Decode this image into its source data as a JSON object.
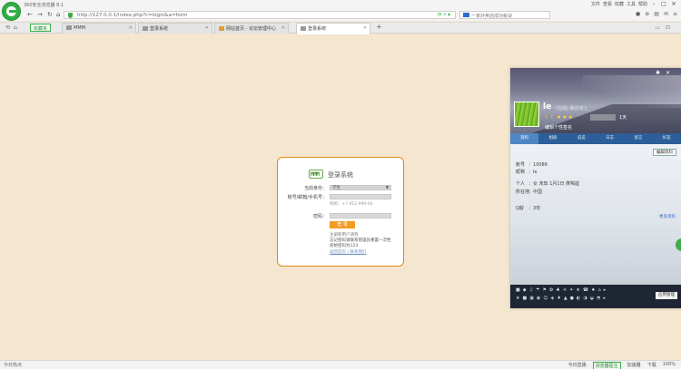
{
  "browser": {
    "title": "360安全浏览器 8.1",
    "menu": [
      "文件",
      "查看",
      "收藏",
      "工具",
      "帮助"
    ],
    "url": "http://127.0.0.1/index.php?c=login&a=form",
    "search_text": "一家外卖店成功秘诀",
    "green_pill": "收藏夹",
    "tabs": [
      {
        "label": "MMM",
        "active": false
      },
      {
        "label": "登录系统",
        "active": false
      },
      {
        "label": "网站首页 - 论坛管理中心",
        "active": false
      },
      {
        "label": "登录系统",
        "active": true
      }
    ]
  },
  "login": {
    "logo_text": "MMM",
    "title": "登录系统",
    "identity_label": "当前身份：",
    "identity_value": "学生",
    "account_label": "账号/邮箱/手机号：",
    "account_hint": "例如：+7 912 999-00",
    "password_label": "密码：",
    "submit_label": "登 录",
    "notes": [
      "注册新用户请到",
      "忘记密码请联系管理员重置一次性",
      "初始密码为123",
      "返回首页 | 联系我们"
    ]
  },
  "qq": {
    "name": "le",
    "name_sub": "(在线) 我在线上",
    "vip_text": "1天",
    "sign": "编辑个性签名",
    "tabs": [
      "资料",
      "相册",
      "说说",
      "日志",
      "留言",
      "好友"
    ],
    "edit_label": "编辑资料",
    "rows": [
      {
        "k": "账号",
        "v": "10086"
      },
      {
        "k": "昵称",
        "v": "le"
      },
      {
        "k": "个人",
        "v": "女  未知  1月1日  摩羯座"
      },
      {
        "k": "所在地",
        "v": "中国"
      },
      {
        "k": "Q龄",
        "v": "3年"
      }
    ],
    "more_label": "更多资料",
    "app_box": "应用管理"
  },
  "status": {
    "left": "今日热点",
    "right": [
      "今日直播",
      "浏览器医生",
      "加速器",
      "下载",
      "100%"
    ]
  }
}
